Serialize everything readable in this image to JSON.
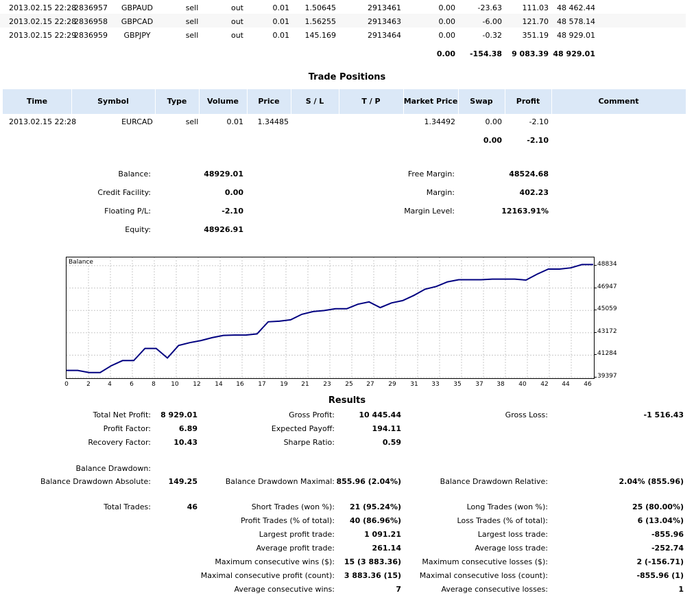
{
  "deals_tail": {
    "rows": [
      {
        "time": "2013.02.15 22:28",
        "deal": "2836957",
        "symbol": "GBPAUD",
        "type": "sell",
        "direction": "out",
        "volume": "0.01",
        "price": "1.50645",
        "order": "2913461",
        "commission": "0.00",
        "swap": "-23.63",
        "profit": "111.03",
        "balance": "48 462.44"
      },
      {
        "time": "2013.02.15 22:28",
        "deal": "2836958",
        "symbol": "GBPCAD",
        "type": "sell",
        "direction": "out",
        "volume": "0.01",
        "price": "1.56255",
        "order": "2913463",
        "commission": "0.00",
        "swap": "-6.00",
        "profit": "121.70",
        "balance": "48 578.14"
      },
      {
        "time": "2013.02.15 22:29",
        "deal": "2836959",
        "symbol": "GBPJPY",
        "type": "sell",
        "direction": "out",
        "volume": "0.01",
        "price": "145.169",
        "order": "2913464",
        "commission": "0.00",
        "swap": "-0.32",
        "profit": "351.19",
        "balance": "48 929.01"
      }
    ],
    "totals": {
      "commission": "0.00",
      "swap": "-154.38",
      "profit": "9 083.39",
      "balance": "48 929.01"
    }
  },
  "trade_positions": {
    "title": "Trade Positions",
    "headers": [
      "Time",
      "Symbol",
      "Type",
      "Volume",
      "Price",
      "S / L",
      "T / P",
      "Market Price",
      "Swap",
      "Profit",
      "Comment"
    ],
    "rows": [
      {
        "time": "2013.02.15 22:28",
        "symbol": "EURCAD",
        "type": "sell",
        "volume": "0.01",
        "price": "1.34485",
        "sl": "",
        "tp": "",
        "market_price": "1.34492",
        "swap": "0.00",
        "profit": "-2.10",
        "comment": ""
      }
    ],
    "totals": {
      "swap": "0.00",
      "profit": "-2.10"
    }
  },
  "account": {
    "balance_label": "Balance:",
    "balance": "48929.01",
    "credit_label": "Credit Facility:",
    "credit": "0.00",
    "floating_label": "Floating P/L:",
    "floating": "-2.10",
    "equity_label": "Equity:",
    "equity": "48926.91",
    "free_margin_label": "Free Margin:",
    "free_margin": "48524.68",
    "margin_label": "Margin:",
    "margin": "402.23",
    "margin_level_label": "Margin Level:",
    "margin_level": "12163.91%"
  },
  "chart_data": {
    "type": "line",
    "title": "Balance",
    "x": [
      0,
      1,
      2,
      3,
      4,
      5,
      6,
      7,
      8,
      9,
      10,
      11,
      12,
      13,
      14,
      15,
      16,
      17,
      18,
      19,
      20,
      21,
      22,
      23,
      24,
      25,
      26,
      27,
      28,
      29,
      30,
      31,
      32,
      33,
      34,
      35,
      36,
      37,
      38,
      39,
      40,
      41,
      42,
      43,
      44,
      45,
      46,
      47
    ],
    "y": [
      40000,
      40000,
      39820,
      39820,
      40400,
      40830,
      40830,
      41850,
      41850,
      41050,
      42100,
      42340,
      42520,
      42760,
      42950,
      42980,
      42980,
      43080,
      44100,
      44150,
      44270,
      44730,
      44960,
      45050,
      45200,
      45200,
      45580,
      45780,
      45300,
      45690,
      45890,
      46330,
      46850,
      47080,
      47470,
      47650,
      47650,
      47650,
      47700,
      47700,
      47700,
      47620,
      48120,
      48550,
      48550,
      48650,
      48929,
      48929
    ],
    "yticks": [
      "39397",
      "41284",
      "43172",
      "45059",
      "46947",
      "48834"
    ],
    "xticks": [
      "0",
      "2",
      "4",
      "6",
      "8",
      "10",
      "12",
      "14",
      "16",
      "17",
      "19",
      "21",
      "23",
      "25",
      "27",
      "29",
      "31",
      "33",
      "35",
      "37",
      "38",
      "40",
      "42",
      "44",
      "46"
    ],
    "ylim": [
      39397,
      49300
    ],
    "grid": true,
    "line_color": "#000080"
  },
  "results": {
    "title": "Results",
    "total_net_profit_label": "Total Net Profit:",
    "total_net_profit": "8 929.01",
    "gross_profit_label": "Gross Profit:",
    "gross_profit": "10 445.44",
    "gross_loss_label": "Gross Loss:",
    "gross_loss": "-1 516.43",
    "profit_factor_label": "Profit Factor:",
    "profit_factor": "6.89",
    "expected_payoff_label": "Expected Payoff:",
    "expected_payoff": "194.11",
    "recovery_factor_label": "Recovery Factor:",
    "recovery_factor": "10.43",
    "sharpe_ratio_label": "Sharpe Ratio:",
    "sharpe_ratio": "0.59",
    "balance_drawdown_label": "Balance Drawdown:",
    "bd_absolute_label": "Balance Drawdown Absolute:",
    "bd_absolute": "149.25",
    "bd_maximal_label": "Balance Drawdown Maximal:",
    "bd_maximal": "855.96 (2.04%)",
    "bd_relative_label": "Balance Drawdown Relative:",
    "bd_relative": "2.04% (855.96)",
    "total_trades_label": "Total Trades:",
    "total_trades": "46",
    "short_trades_label": "Short Trades (won %):",
    "short_trades": "21 (95.24%)",
    "long_trades_label": "Long Trades (won %):",
    "long_trades": "25 (80.00%)",
    "profit_trades_label": "Profit Trades (% of total):",
    "profit_trades": "40 (86.96%)",
    "loss_trades_label": "Loss Trades (% of total):",
    "loss_trades": "6 (13.04%)",
    "largest_profit_label": "Largest profit trade:",
    "largest_profit": "1 091.21",
    "largest_loss_label": "Largest loss trade:",
    "largest_loss": "-855.96",
    "avg_profit_label": "Average profit trade:",
    "avg_profit": "261.14",
    "avg_loss_label": "Average loss trade:",
    "avg_loss": "-252.74",
    "max_consec_wins_label": "Maximum consecutive wins ($):",
    "max_consec_wins": "15 (3 883.36)",
    "max_consec_losses_label": "Maximum consecutive losses ($):",
    "max_consec_losses": "2 (-156.71)",
    "maximal_consec_profit_label": "Maximal consecutive profit (count):",
    "maximal_consec_profit": "3 883.36 (15)",
    "maximal_consec_loss_label": "Maximal consecutive loss (count):",
    "maximal_consec_loss": "-855.96 (1)",
    "avg_consec_wins_label": "Average consecutive wins:",
    "avg_consec_wins": "7",
    "avg_consec_losses_label": "Average consecutive losses:",
    "avg_consec_losses": "1"
  }
}
